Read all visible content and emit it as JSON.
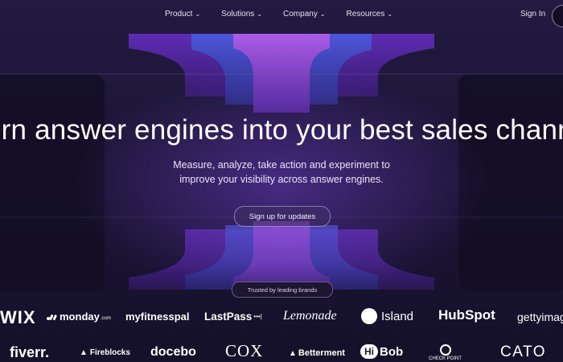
{
  "nav": {
    "items": [
      {
        "label": "Product"
      },
      {
        "label": "Solutions"
      },
      {
        "label": "Company"
      },
      {
        "label": "Resources"
      }
    ],
    "signin": "Sign In",
    "chevron_icon": "chevron-down-icon"
  },
  "hero": {
    "headline": "urn answer engines into your best sales chann",
    "subtitle_line1": "Measure, analyze, take action and experiment to",
    "subtitle_line2": "improve your visibility across answer engines.",
    "cta": "Sign up for updates"
  },
  "brands": {
    "label": "Trusted by leading brands",
    "row1": [
      "WIX",
      "monday",
      ".com",
      "myfitnesspal",
      "LastPass",
      "•••|",
      "Lemonade",
      "Island",
      "HubSpot",
      "gettyimag"
    ],
    "row2": [
      "fiverr.",
      "Fireblocks",
      "docebo",
      "COX",
      "Betterment",
      "Bob",
      "CHECK POINT",
      "CATO"
    ]
  },
  "colors": {
    "background": "#1a1330",
    "accent_purple": "#7b3fd6",
    "accent_blue": "#3b58c9",
    "text": "#ffffff"
  }
}
